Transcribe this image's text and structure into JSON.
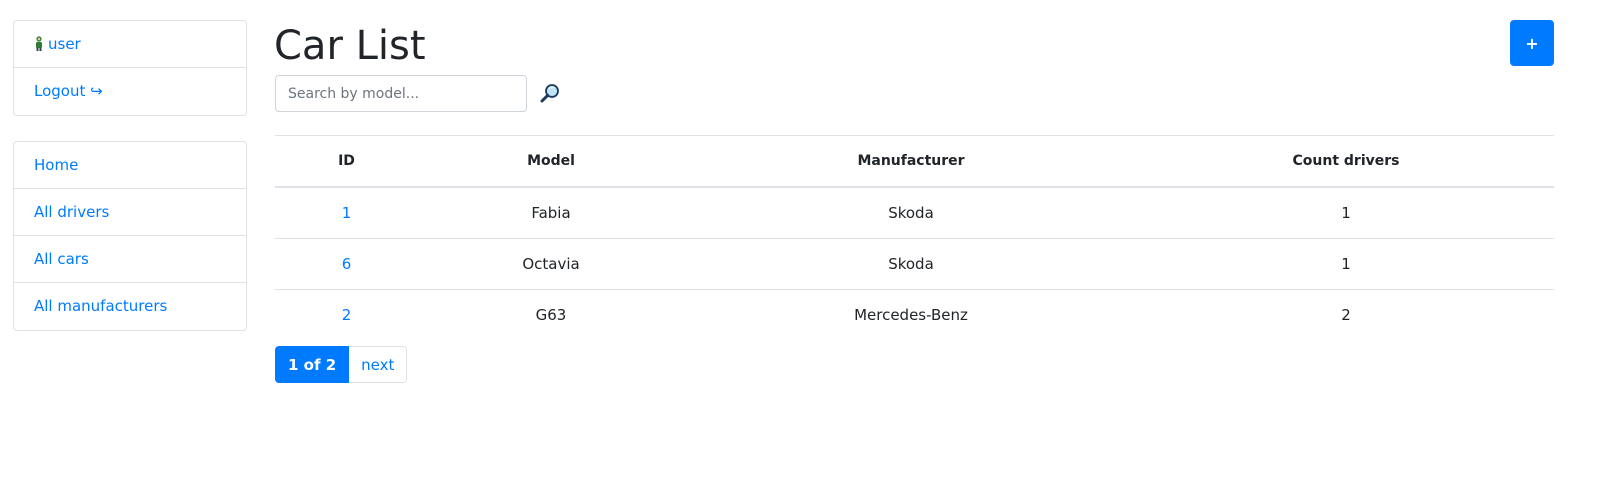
{
  "sidebar": {
    "user": {
      "label": "user",
      "icon": "person-icon"
    },
    "logout": {
      "label": "Logout ↪"
    },
    "nav": [
      {
        "label": "Home"
      },
      {
        "label": "All drivers"
      },
      {
        "label": "All cars"
      },
      {
        "label": "All manufacturers"
      }
    ]
  },
  "page": {
    "title": "Car List",
    "add_button_label": "+"
  },
  "search": {
    "placeholder": "Search by model...",
    "value": "",
    "icon": "magnifier-icon"
  },
  "table": {
    "headers": [
      "ID",
      "Model",
      "Manufacturer",
      "Count drivers"
    ],
    "rows": [
      {
        "id": "1",
        "model": "Fabia",
        "manufacturer": "Skoda",
        "count": "1"
      },
      {
        "id": "6",
        "model": "Octavia",
        "manufacturer": "Skoda",
        "count": "1"
      },
      {
        "id": "2",
        "model": "G63",
        "manufacturer": "Mercedes-Benz",
        "count": "2"
      }
    ]
  },
  "pagination": {
    "current": "1 of 2",
    "next": "next"
  },
  "colors": {
    "accent": "#007bff",
    "border": "#dee2e6",
    "text": "#212529"
  }
}
